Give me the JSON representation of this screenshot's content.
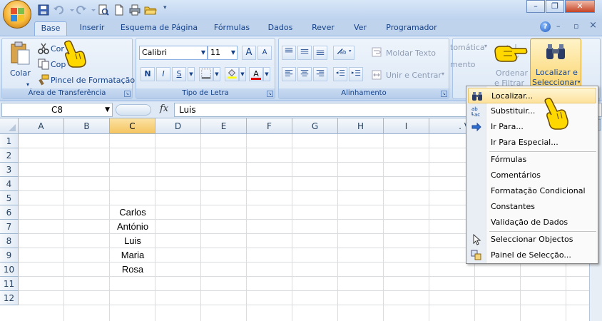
{
  "tabs": [
    "Base",
    "Inserir",
    "Esquema de Página",
    "Fórmulas",
    "Dados",
    "Rever",
    "Ver",
    "Programador"
  ],
  "help_label": "?",
  "mini_window": {
    "minimize": "–",
    "restore": "▫",
    "close": "×"
  },
  "window_controls": {
    "minimize": "–",
    "restore": "❐",
    "close": "✕"
  },
  "clipboard": {
    "paste_label": "Colar",
    "cut_label": "Cor",
    "copy_label": "Cop",
    "format_painter_label": "Pincel de Formatação",
    "group_label": "Área de Transferência"
  },
  "font": {
    "name": "Calibri",
    "size": "11",
    "grow_label": "A",
    "shrink_label": "A",
    "bold_label": "N",
    "italic_label": "I",
    "underline_label": "S",
    "font_color_label": "A",
    "group_label": "Tipo de Letra"
  },
  "alignment": {
    "wrap_label": "Moldar Texto",
    "merge_label": "Unir e Centrar",
    "group_label": "Alinhamento"
  },
  "editing": {
    "autosum_label": "tomática",
    "fill_label": "mento",
    "sort_label_1": "Ordenar",
    "sort_label_2": "e Filtrar",
    "find_label_1": "Localizar e",
    "find_label_2": "Seleccionar"
  },
  "formula_bar": {
    "name_box": "C8",
    "fx": "fx",
    "content": "Luis"
  },
  "sheet": {
    "columns": [
      "A",
      "B",
      "C",
      "D",
      "E",
      "F",
      "G",
      "H",
      "I"
    ],
    "partial_column": ". V",
    "rows": [
      "1",
      "2",
      "3",
      "4",
      "5",
      "6",
      "7",
      "8",
      "9",
      "10",
      "11",
      "12"
    ],
    "values": [
      {
        "row": "6",
        "col": "C",
        "text": "Carlos"
      },
      {
        "row": "7",
        "col": "C",
        "text": "António"
      },
      {
        "row": "8",
        "col": "C",
        "text": "Luis"
      },
      {
        "row": "9",
        "col": "C",
        "text": "Maria"
      },
      {
        "row": "10",
        "col": "C",
        "text": "Rosa"
      }
    ]
  },
  "menu": {
    "items": [
      {
        "label": "Localizar...",
        "icon": "binoculars-icon",
        "highlighted": true
      },
      {
        "label": "Substituir...",
        "icon": "replace-icon"
      },
      {
        "label": "Ir Para...",
        "icon": "arrow-right-icon"
      },
      {
        "label": "Ir Para Especial..."
      },
      {
        "label": "Fórmulas"
      },
      {
        "label": "Comentários"
      },
      {
        "label": "Formatação Condicional"
      },
      {
        "label": "Constantes"
      },
      {
        "label": "Validação de Dados"
      },
      {
        "label": "Seleccionar Objectos",
        "icon": "pointer-icon"
      },
      {
        "label": "Painel de Selecção...",
        "icon": "selection-pane-icon"
      }
    ]
  },
  "colors": {
    "accent": "#15428b",
    "highlight": "#fde29c",
    "selected_header": "#f5c45f"
  }
}
